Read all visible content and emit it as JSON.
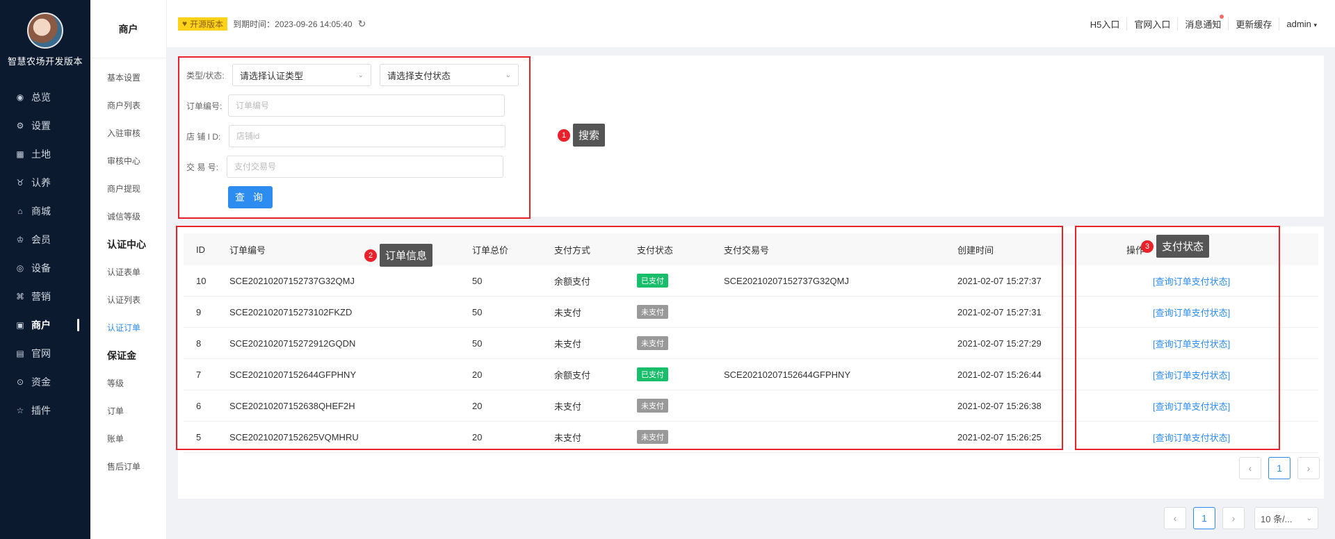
{
  "brand": {
    "name": "智慧农场开发版本"
  },
  "nav": [
    {
      "label": "总览",
      "icon": "dashboard-icon",
      "glyph": "◉"
    },
    {
      "label": "设置",
      "icon": "gear-icon",
      "glyph": "⚙"
    },
    {
      "label": "土地",
      "icon": "grid-icon",
      "glyph": "▦"
    },
    {
      "label": "认养",
      "icon": "cow-icon",
      "glyph": "♉"
    },
    {
      "label": "商城",
      "icon": "shop-icon",
      "glyph": "⌂"
    },
    {
      "label": "会员",
      "icon": "crown-icon",
      "glyph": "♔"
    },
    {
      "label": "设备",
      "icon": "device-icon",
      "glyph": "◎"
    },
    {
      "label": "营销",
      "icon": "command-icon",
      "glyph": "⌘"
    },
    {
      "label": "商户",
      "icon": "store-icon",
      "glyph": "▣",
      "active": true
    },
    {
      "label": "官网",
      "icon": "website-icon",
      "glyph": "▤"
    },
    {
      "label": "资金",
      "icon": "money-icon",
      "glyph": "⊙"
    },
    {
      "label": "插件",
      "icon": "star-icon",
      "glyph": "☆"
    }
  ],
  "submenu": {
    "title": "商户",
    "items": [
      {
        "label": "基本设置"
      },
      {
        "label": "商户列表"
      },
      {
        "label": "入驻审核"
      },
      {
        "label": "审核中心"
      },
      {
        "label": "商户提现"
      },
      {
        "label": "诚信等级"
      },
      {
        "label": "认证中心",
        "group": true
      },
      {
        "label": "认证表单"
      },
      {
        "label": "认证列表"
      },
      {
        "label": "认证订单",
        "active": true
      },
      {
        "label": "保证金",
        "group": true
      },
      {
        "label": "等级"
      },
      {
        "label": "订单"
      },
      {
        "label": "账单"
      },
      {
        "label": "售后订单"
      }
    ]
  },
  "header": {
    "badge": "开源版本",
    "expire_label": "到期时间：2023-09-26 14:05:40",
    "links": [
      "H5入口",
      "官网入口",
      "消息通知",
      "更新缓存",
      "admin"
    ]
  },
  "search": {
    "type_label": "类型/状态:",
    "auth_type_select": "请选择认证类型",
    "pay_status_select": "请选择支付状态",
    "order_no_label": "订单编号:",
    "order_no_placeholder": "订单编号",
    "shop_id_label": "店 铺 I D:",
    "shop_id_placeholder": "店铺id",
    "trade_no_label": "交 易 号:",
    "trade_no_placeholder": "支付交易号",
    "query_button": "查 询"
  },
  "table": {
    "columns": [
      "ID",
      "订单编号",
      "订单总价",
      "支付方式",
      "支付状态",
      "支付交易号",
      "创建时间",
      "操作"
    ],
    "rows": [
      {
        "id": "10",
        "order_no": "SCE20210207152737G32QMJ",
        "total": "50",
        "method": "余额支付",
        "status": "已支付",
        "paid": true,
        "trade_no": "SCE20210207152737G32QMJ",
        "created": "2021-02-07 15:27:37",
        "op": "[查询订单支付状态]"
      },
      {
        "id": "9",
        "order_no": "SCE202102071527310​2FKZD",
        "total": "50",
        "method": "未支付",
        "status": "未支付",
        "paid": false,
        "trade_no": "",
        "created": "2021-02-07 15:27:31",
        "op": "[查询订单支付状态]"
      },
      {
        "id": "8",
        "order_no": "SCE20210207152729​12GQDN",
        "total": "50",
        "method": "未支付",
        "status": "未支付",
        "paid": false,
        "trade_no": "",
        "created": "2021-02-07 15:27:29",
        "op": "[查询订单支付状态]"
      },
      {
        "id": "7",
        "order_no": "SCE20210207152644GFPHNY",
        "total": "20",
        "method": "余额支付",
        "status": "已支付",
        "paid": true,
        "trade_no": "SCE20210207152644GFPHNY",
        "created": "2021-02-07 15:26:44",
        "op": "[查询订单支付状态]"
      },
      {
        "id": "6",
        "order_no": "SCE20210207152638QHEF2H",
        "total": "20",
        "method": "未支付",
        "status": "未支付",
        "paid": false,
        "trade_no": "",
        "created": "2021-02-07 15:26:38",
        "op": "[查询订单支付状态]"
      },
      {
        "id": "5",
        "order_no": "SCE20210207152625VQMHRU",
        "total": "20",
        "method": "未支付",
        "status": "未支付",
        "paid": false,
        "trade_no": "",
        "created": "2021-02-07 15:26:25",
        "op": "[查询订单支付状态]"
      }
    ]
  },
  "pagination": {
    "inner_page": "1",
    "outer_page": "1",
    "page_size": "10 条/..."
  },
  "annotations": [
    {
      "num": "1",
      "label": "搜索"
    },
    {
      "num": "2",
      "label": "订单信息"
    },
    {
      "num": "3",
      "label": "支付状态"
    }
  ],
  "colors": {
    "sidebar": "#0c1a30",
    "primary": "#2d8cf0",
    "paid": "#19be6b",
    "unpaid": "#999999",
    "annotation": "#e8212b"
  }
}
